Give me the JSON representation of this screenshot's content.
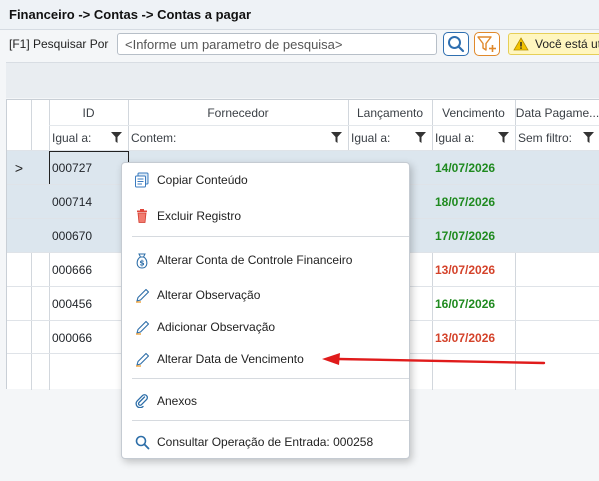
{
  "header": {
    "breadcrumb": "Financeiro -> Contas -> Contas a pagar"
  },
  "search": {
    "label": "[F1] Pesquisar Por",
    "placeholder": "<Informe um parametro de pesquisa>",
    "search_icon": "search-icon",
    "filter_add_icon": "filter-add-icon",
    "warning_text": "Você está uti"
  },
  "grid": {
    "columns": [
      {
        "header": "ID",
        "filter": "Igual a:"
      },
      {
        "header": "Fornecedor",
        "filter": "Contem:"
      },
      {
        "header": "Lançamento",
        "filter": "Igual a:"
      },
      {
        "header": "Vencimento",
        "filter": "Igual a:"
      },
      {
        "header": "Data Pagame...",
        "filter": "Sem filtro:"
      }
    ],
    "selected_marker": ">",
    "rows": [
      {
        "id": "000727",
        "vencimento": "14/07/2026",
        "status": "green"
      },
      {
        "id": "000714",
        "vencimento": "18/07/2026",
        "status": "green"
      },
      {
        "id": "000670",
        "vencimento": "17/07/2026",
        "status": "green"
      },
      {
        "id": "000666",
        "vencimento": "13/07/2026",
        "status": "red"
      },
      {
        "id": "000456",
        "vencimento": "16/07/2026",
        "status": "green"
      },
      {
        "id": "000066",
        "vencimento": "13/07/2026",
        "status": "red"
      }
    ]
  },
  "context_menu": {
    "items": [
      {
        "label": "Copiar Conteúdo",
        "icon": "copy-icon"
      },
      {
        "label": "Excluir Registro",
        "icon": "trash-icon"
      },
      {
        "label": "Alterar Conta de Controle Financeiro",
        "icon": "money-bag-icon"
      },
      {
        "label": "Alterar Observação",
        "icon": "pencil-icon"
      },
      {
        "label": "Adicionar Observação",
        "icon": "pencil-icon"
      },
      {
        "label": "Alterar Data de Vencimento",
        "icon": "pencil-icon"
      },
      {
        "label": "Anexos",
        "icon": "paperclip-icon"
      },
      {
        "label": "Consultar Operação de Entrada: 000258",
        "icon": "search-icon"
      }
    ]
  },
  "colors": {
    "green_date": "#1f8a1f",
    "red_date": "#d4422a",
    "selected_row": "#dce6ee",
    "annotation_arrow": "#e01b1b"
  }
}
